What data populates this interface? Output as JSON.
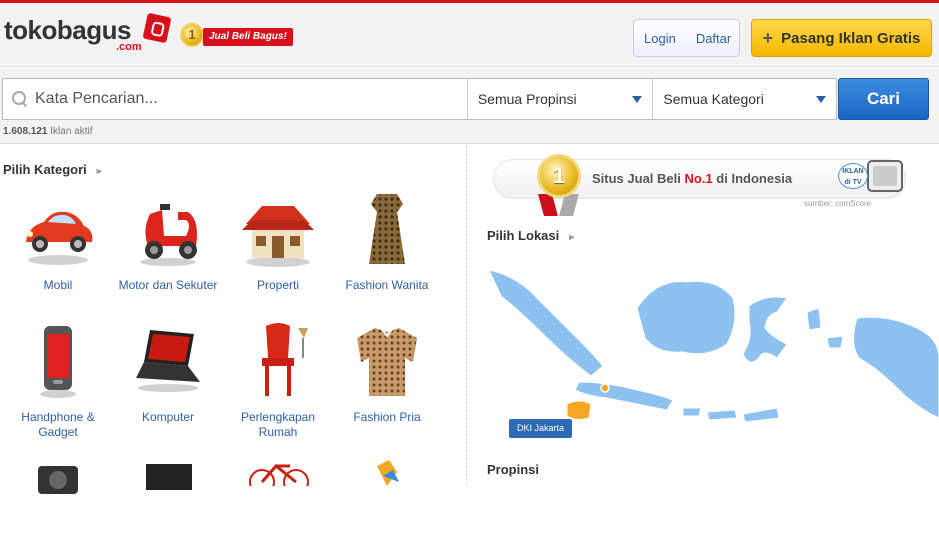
{
  "header": {
    "logo_main": "tokobagus",
    "logo_suffix": ".com",
    "badge_number": "1",
    "badge_tagline": "Jual Beli Bagus!",
    "login_label": "Login",
    "register_label": "Daftar",
    "post_ad_label": "Pasang Iklan Gratis"
  },
  "search": {
    "placeholder": "Kata Pencarian...",
    "province_select": "Semua Propinsi",
    "category_select": "Semua Kategori",
    "submit_label": "Cari",
    "active_count": "1.608.121",
    "active_label": "Iklan aktif"
  },
  "categories": {
    "title": "Pilih Kategori",
    "items": [
      {
        "label": "Mobil",
        "icon": "car-icon"
      },
      {
        "label": "Motor dan Sekuter",
        "icon": "scooter-icon"
      },
      {
        "label": "Properti",
        "icon": "house-icon"
      },
      {
        "label": "Fashion Wanita",
        "icon": "dress-icon"
      },
      {
        "label": "Handphone &",
        "label2": "Gadget",
        "icon": "phone-icon"
      },
      {
        "label": "Komputer",
        "icon": "laptop-icon"
      },
      {
        "label": "Perlengkapan",
        "label2": "Rumah",
        "icon": "chair-icon"
      },
      {
        "label": "Fashion Pria",
        "icon": "shirt-icon"
      }
    ]
  },
  "banner": {
    "medal_number": "1",
    "text_prefix": "Situs Jual Beli",
    "text_highlight": "No.1",
    "text_suffix": "di Indonesia",
    "tv_label_1": "IKLAN",
    "tv_label_2": "di TV",
    "source": "sumber: comScore"
  },
  "location": {
    "title": "Pilih Lokasi",
    "selected_region": "DKI Jakarta",
    "province_title": "Propinsi"
  },
  "colors": {
    "brand_red": "#d8101c",
    "link_blue": "#2d5fa6",
    "map_blue": "#8dc2f0",
    "highlight_orange": "#f5a623"
  }
}
